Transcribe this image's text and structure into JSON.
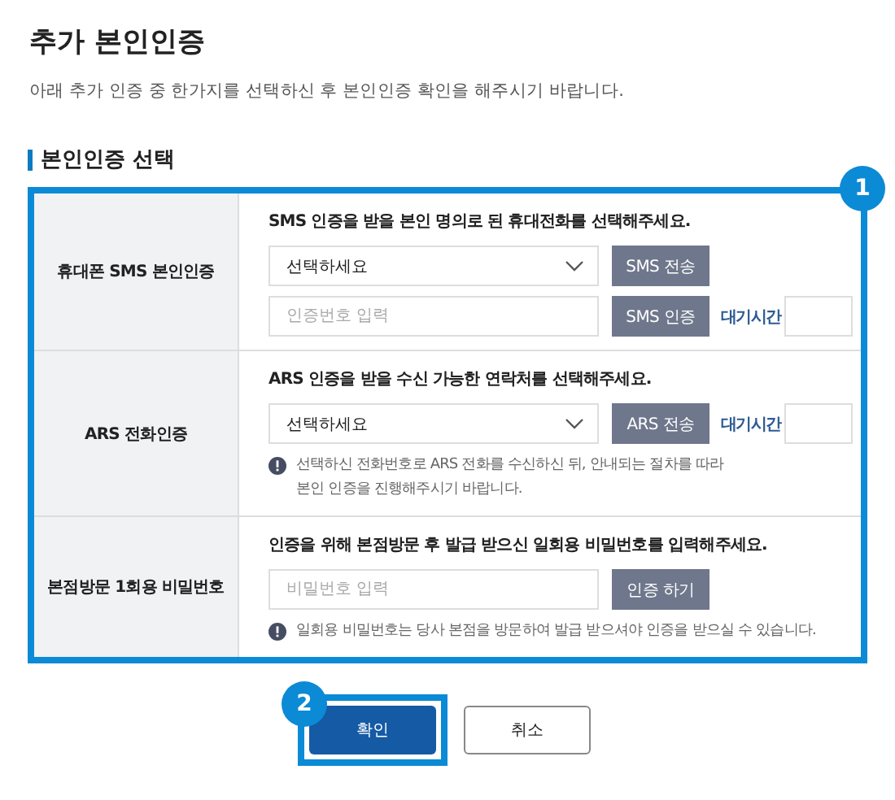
{
  "title": "추가 본인인증",
  "subtitle": "아래 추가 인증 중 한가지를 선택하신 후 본인인증 확인을 해주시기 바랍니다.",
  "section_title": "본인인증 선택",
  "callouts": [
    "1",
    "2"
  ],
  "rows": [
    {
      "label": "휴대폰 SMS 본인인증",
      "prompt": "SMS 인증을 받을 본인 명의로 된 휴대전화를 선택해주세요.",
      "lines": [
        [
          {
            "kind": "select",
            "value": "선택하세요"
          },
          {
            "kind": "button",
            "label": "SMS 전송"
          }
        ],
        [
          {
            "kind": "input",
            "placeholder": "인증번호 입력"
          },
          {
            "kind": "button",
            "label": "SMS 인증"
          },
          {
            "kind": "wait",
            "label": "대기시간"
          }
        ]
      ]
    },
    {
      "label": "ARS 전화인증",
      "prompt": "ARS 인증을 받을 수신 가능한 연락처를 선택해주세요.",
      "lines": [
        [
          {
            "kind": "select",
            "value": "선택하세요"
          },
          {
            "kind": "button",
            "label": "ARS 전송"
          },
          {
            "kind": "wait",
            "label": "대기시간"
          }
        ]
      ],
      "note": "선택하신 전화번호로 ARS 전화를 수신하신 뒤, 안내되는 절차를 따라 본인 인증을 진행해주시기 바랍니다."
    },
    {
      "label": "본점방문 1회용 비밀번호",
      "prompt": "인증을 위해 본점방문 후 발급 받으신 일회용 비밀번호를 입력해주세요.",
      "lines": [
        [
          {
            "kind": "input",
            "placeholder": "비밀번호 입력"
          },
          {
            "kind": "button",
            "label": "인증 하기"
          }
        ]
      ],
      "note": "일회용 비밀번호는 당사 본점을 방문하여 발급 받으셔야 인증을 받으실 수 있습니다."
    }
  ],
  "buttons": [
    {
      "label": "확인",
      "primary": true
    },
    {
      "label": "취소",
      "primary": false
    }
  ]
}
